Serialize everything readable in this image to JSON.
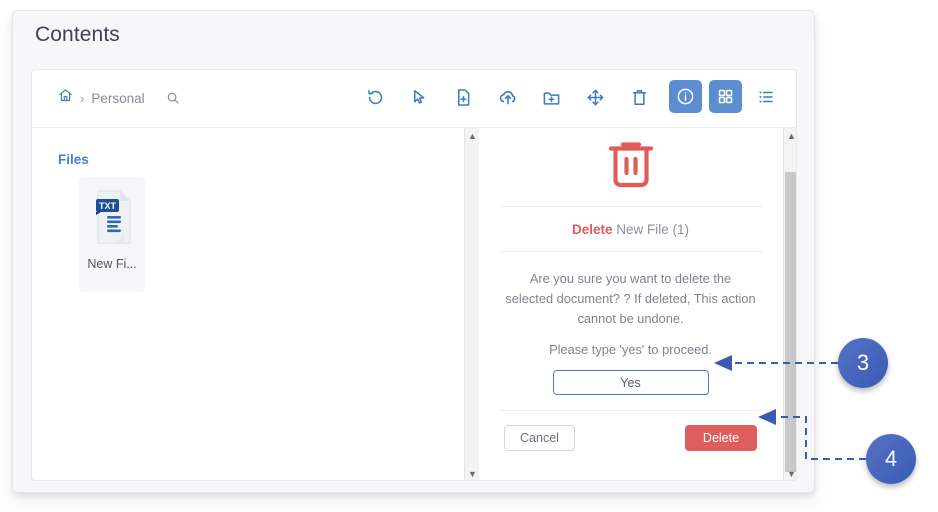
{
  "page": {
    "title": "Contents"
  },
  "toolbar": {
    "breadcrumb": {
      "home_icon": "home-icon",
      "separator": "›",
      "current": "Personal",
      "search_icon": "search-icon"
    },
    "actions": [
      {
        "icon": "refresh-icon",
        "name": "refresh-button"
      },
      {
        "icon": "cursor-select-icon",
        "name": "select-button"
      },
      {
        "icon": "new-file-icon",
        "name": "new-file-button"
      },
      {
        "icon": "upload-cloud-icon",
        "name": "upload-button"
      },
      {
        "icon": "new-folder-icon",
        "name": "new-folder-button"
      },
      {
        "icon": "move-icon",
        "name": "move-button"
      },
      {
        "icon": "trash-icon",
        "name": "delete-button"
      }
    ],
    "view_controls": [
      {
        "icon": "info-icon",
        "name": "info-toggle",
        "active": true
      },
      {
        "icon": "grid-view-icon",
        "name": "grid-view-toggle",
        "active": true
      },
      {
        "icon": "list-view-icon",
        "name": "list-view-toggle",
        "active": false
      }
    ]
  },
  "left_pane": {
    "section_label": "Files",
    "files": [
      {
        "name": "New Fi...",
        "type_badge": "TXT"
      }
    ]
  },
  "dialog": {
    "icon": "trash-icon-large",
    "heading_action": "Delete",
    "heading_target": "New File (1)",
    "message": "Are you sure you want to delete the selected document? ? If deleted, This action cannot be undone.",
    "prompt": "Please type 'yes' to proceed.",
    "input_value": "Yes",
    "input_placeholder": "",
    "cancel_label": "Cancel",
    "delete_label": "Delete"
  },
  "annotations": {
    "badges": [
      {
        "number": "3",
        "target": "confirm-input"
      },
      {
        "number": "4",
        "target": "delete-button"
      }
    ]
  },
  "colors": {
    "accent_blue": "#4a7fc1",
    "toolbar_active": "#5b8dd0",
    "danger_red": "#dd5e5e",
    "badge_blue": "#3a5ab4",
    "text_muted": "#82828f"
  }
}
